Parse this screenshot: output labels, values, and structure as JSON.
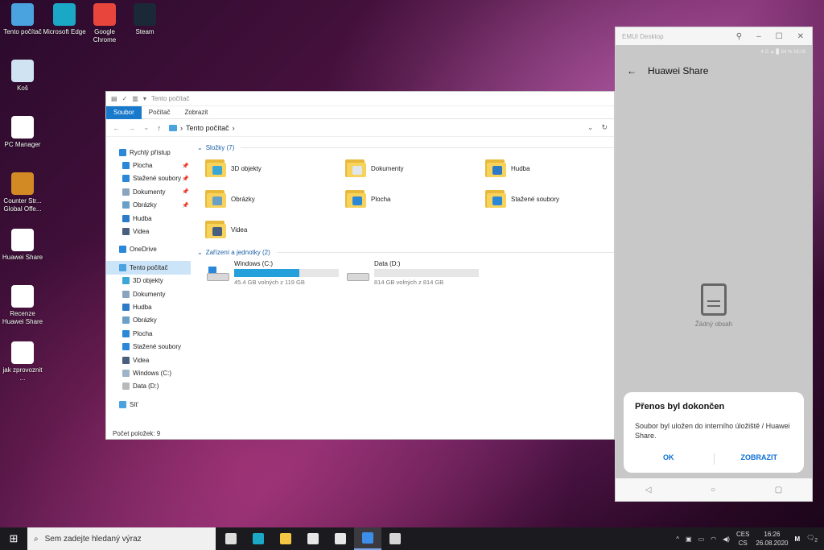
{
  "desktop": {
    "icons": [
      {
        "label": "Tento počítač",
        "icon": "computer-icon",
        "color": "#4aa3df"
      },
      {
        "label": "Microsoft Edge",
        "icon": "edge-icon",
        "color": "#1ba8c7"
      },
      {
        "label": "Google Chrome",
        "icon": "chrome-icon",
        "color": "#e8453c"
      },
      {
        "label": "Steam",
        "icon": "steam-icon",
        "color": "#1b2838"
      },
      {
        "label": "Koš",
        "icon": "recycle-bin-icon",
        "color": "#cfe3f2"
      },
      {
        "label": "PC Manager",
        "icon": "pc-manager-icon",
        "color": "#ffffff"
      },
      {
        "label": "Counter Str... Global Offe...",
        "icon": "csgo-icon",
        "color": "#d28a25"
      },
      {
        "label": "Huawei Share",
        "icon": "image-file-icon",
        "color": "#ffffff"
      },
      {
        "label": "Recenze Huawei Share",
        "icon": "image-file-icon",
        "color": "#ffffff"
      },
      {
        "label": "jak zprovoznit ...",
        "icon": "image-file-icon",
        "color": "#ffffff"
      }
    ]
  },
  "explorer": {
    "title": "Tento počítač",
    "ribbon_tabs": [
      "Soubor",
      "Počítač",
      "Zobrazit"
    ],
    "address_path": "Tento počítač",
    "nav": {
      "quick_access": "Rychlý přístup",
      "quick_items": [
        {
          "label": "Plocha",
          "color": "#2b88d8",
          "pinned": true
        },
        {
          "label": "Stažené soubory",
          "color": "#2b88d8",
          "pinned": true
        },
        {
          "label": "Dokumenty",
          "color": "#8aa4c0",
          "pinned": true
        },
        {
          "label": "Obrázky",
          "color": "#6aa0c8",
          "pinned": true
        },
        {
          "label": "Hudba",
          "color": "#2b7bc8",
          "pinned": false
        },
        {
          "label": "Videa",
          "color": "#4a5e80",
          "pinned": false
        }
      ],
      "onedrive": "OneDrive",
      "this_pc": "Tento počítač",
      "pc_items": [
        {
          "label": "3D objekty",
          "color": "#3aa7d6"
        },
        {
          "label": "Dokumenty",
          "color": "#8aa4c0"
        },
        {
          "label": "Hudba",
          "color": "#2b7bc8"
        },
        {
          "label": "Obrázky",
          "color": "#6aa0c8"
        },
        {
          "label": "Plocha",
          "color": "#2b88d8"
        },
        {
          "label": "Stažené soubory",
          "color": "#2b88d8"
        },
        {
          "label": "Videa",
          "color": "#4a5e80"
        },
        {
          "label": "Windows (C:)",
          "color": "#9fb4c8"
        },
        {
          "label": "Data (D:)",
          "color": "#b9b9b9"
        }
      ],
      "network": "Síť"
    },
    "folders_header": "Složky (7)",
    "folders": [
      {
        "label": "3D objekty",
        "badge": "#3aa7d6"
      },
      {
        "label": "Dokumenty",
        "badge": "#dfe6ee"
      },
      {
        "label": "Hudba",
        "badge": "#2b7bc8"
      },
      {
        "label": "Obrázky",
        "badge": "#6aa0c8"
      },
      {
        "label": "Plocha",
        "badge": "#2b88d8"
      },
      {
        "label": "Stažené soubory",
        "badge": "#2b88d8"
      },
      {
        "label": "Videa",
        "badge": "#4a5e80"
      }
    ],
    "drives_header": "Zařízení a jednotky (2)",
    "drives": [
      {
        "label": "Windows (C:)",
        "free": "45.4 GB volných z 119 GB",
        "used_fraction": 0.62
      },
      {
        "label": "Data (D:)",
        "free": "814 GB volných z 814 GB",
        "used_fraction": 0.0
      }
    ],
    "status": "Počet položek: 9"
  },
  "phone": {
    "window_title": "EMUI Desktop",
    "status_text": "4 G  ▲  ▊ 84 %  16:26",
    "header": "Huawei Share",
    "empty_text": "Žádný obsah",
    "dialog": {
      "title": "Přenos byl dokončen",
      "message": "Soubor byl uložen do interního úložiště / Huawei Share.",
      "ok": "OK",
      "show": "ZOBRAZIT"
    }
  },
  "taskbar": {
    "search_placeholder": "Sem zadejte hledaný výraz",
    "apps": [
      {
        "name": "task-view",
        "color": "#dddddd"
      },
      {
        "name": "edge",
        "color": "#1ba8c7"
      },
      {
        "name": "file-explorer",
        "color": "#f3c644"
      },
      {
        "name": "store",
        "color": "#e6e6e6"
      },
      {
        "name": "mail",
        "color": "#e6e6e6"
      },
      {
        "name": "emui-desktop",
        "color": "#3c8ee8"
      },
      {
        "name": "huawei-app",
        "color": "#d5d5d5"
      }
    ],
    "lang_top": "CES",
    "lang_bottom": "CS",
    "time": "16:26",
    "date": "26.08.2020",
    "notifications": "2"
  }
}
